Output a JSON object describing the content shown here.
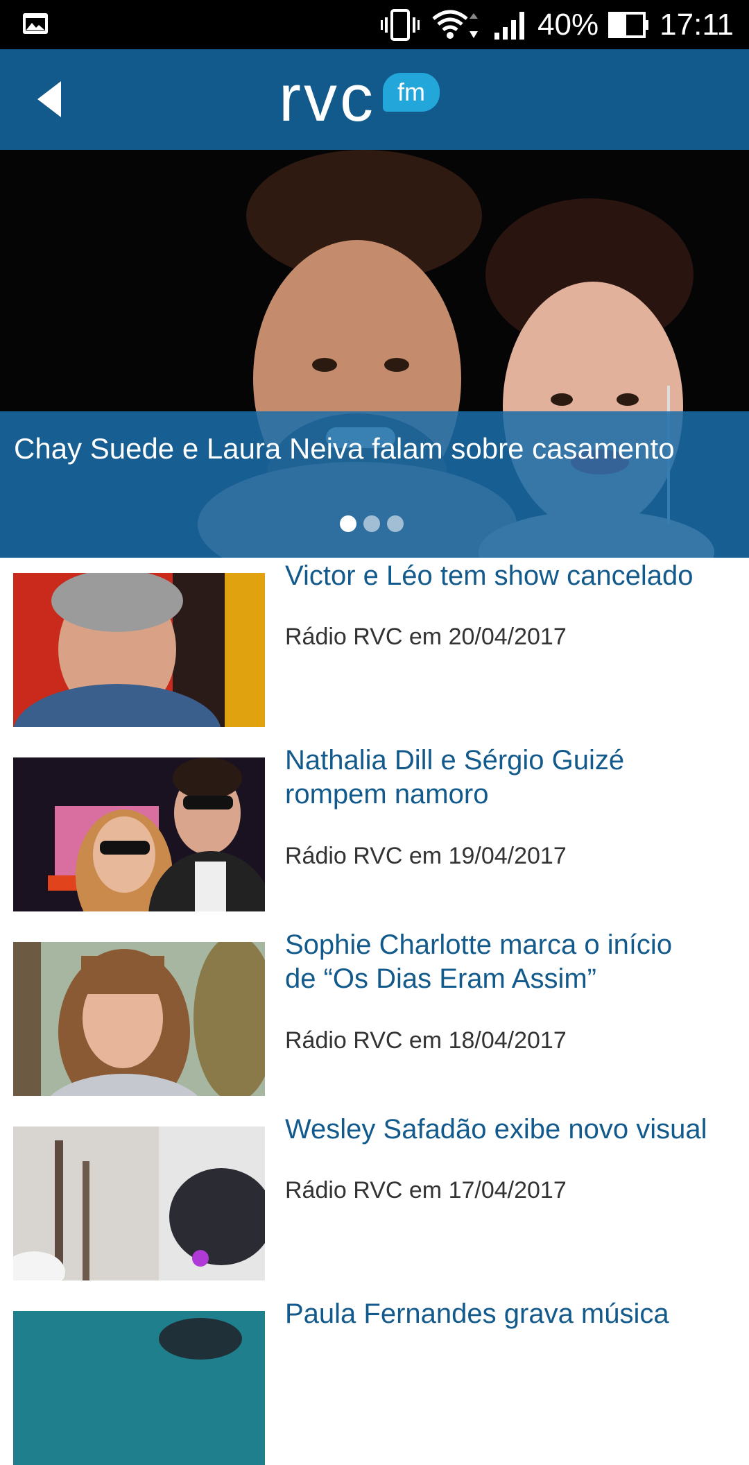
{
  "status_bar": {
    "battery": "40%",
    "time": "17:11"
  },
  "header": {
    "logo_main": "rvc",
    "logo_badge": "fm"
  },
  "hero": {
    "title": "Chay Suede e Laura Neiva falam sobre casamento",
    "page_count": 3,
    "active_page": 1
  },
  "news": [
    {
      "title_lines": [
        "Victor e Léo tem show cancelado"
      ],
      "meta": "Rádio RVC em 20/04/2017"
    },
    {
      "title_lines": [
        "Nathalia Dill e Sérgio Guizé",
        "rompem namoro"
      ],
      "meta": "Rádio RVC em 19/04/2017"
    },
    {
      "title_lines": [
        "Sophie Charlotte marca o início",
        "de “Os Dias Eram Assim”"
      ],
      "meta": "Rádio RVC em 18/04/2017"
    },
    {
      "title_lines": [
        "Wesley Safadão exibe novo visual"
      ],
      "meta": "Rádio RVC em 17/04/2017"
    },
    {
      "title_lines": [
        "Paula Fernandes grava música"
      ],
      "meta": ""
    }
  ],
  "colors": {
    "header_bg": "#135a8c",
    "accent": "#23a6da",
    "title_text": "#135a8c"
  }
}
